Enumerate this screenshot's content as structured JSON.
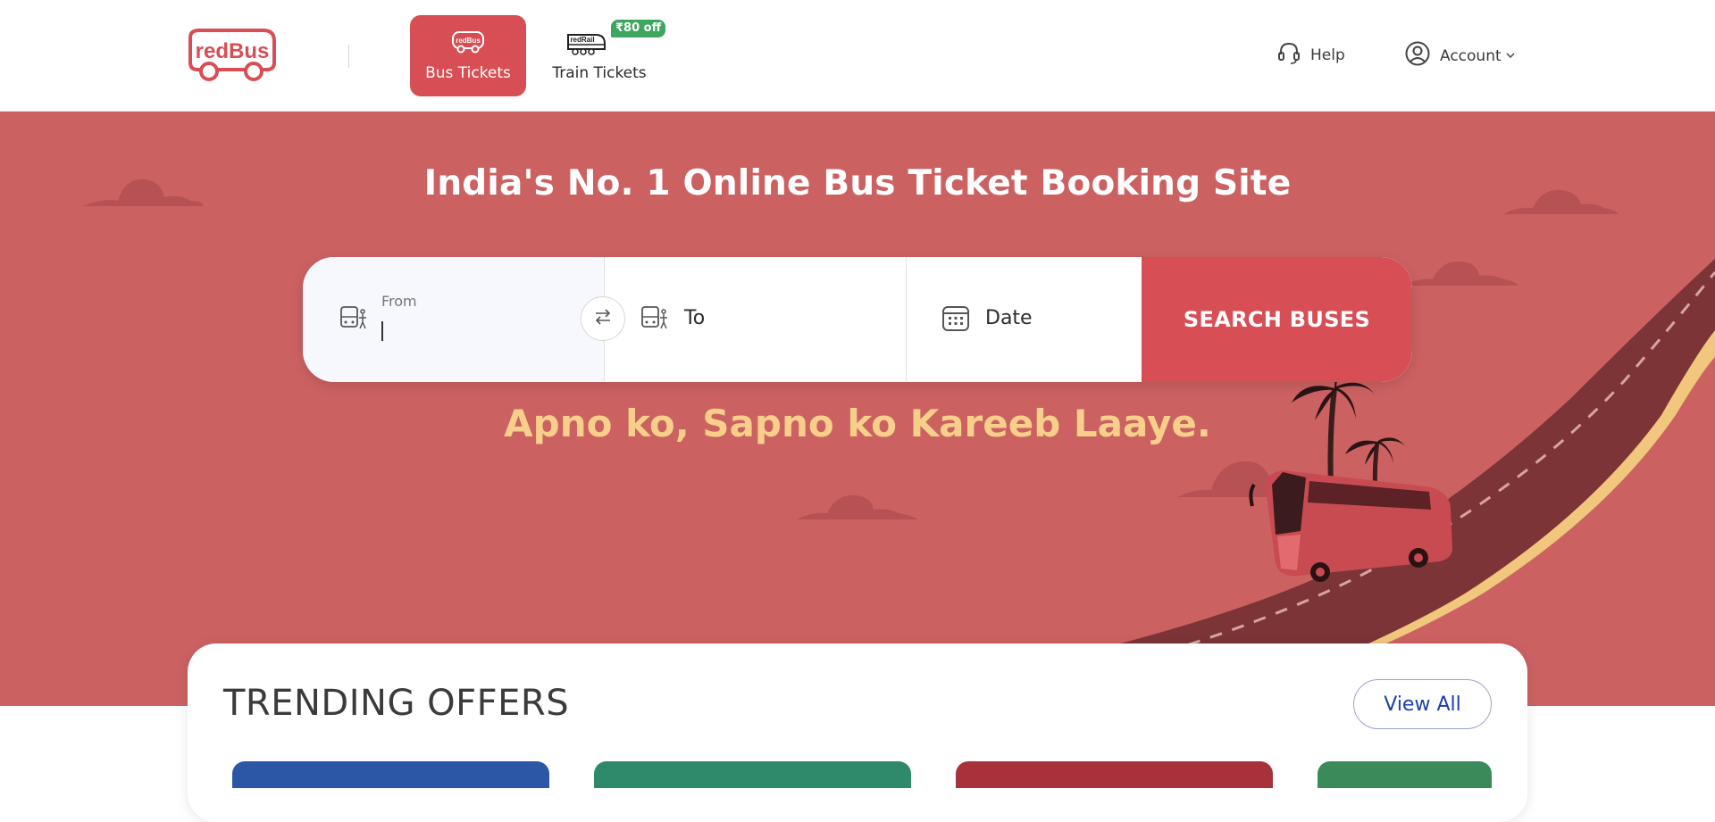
{
  "header": {
    "logo_text": "redBus",
    "tabs": [
      {
        "label": "Bus Tickets",
        "icon": "bus-icon",
        "active": true
      },
      {
        "label": "Train Tickets",
        "icon": "train-icon",
        "active": false
      }
    ],
    "train_badge": "₹80 off",
    "train_logo_text": "redRail",
    "help_label": "Help",
    "account_label": "Account"
  },
  "hero": {
    "title": "India's No. 1 Online Bus Ticket Booking Site",
    "tagline": "Apno ko, Sapno ko Kareeb Laaye."
  },
  "search": {
    "from_label": "From",
    "from_value": "",
    "to_label": "To",
    "date_label": "Date",
    "button_label": "SEARCH BUSES"
  },
  "offers": {
    "title": "TRENDING OFFERS",
    "view_all_label": "View All"
  },
  "colors": {
    "brand_red": "#d84e55",
    "hero_bg": "#cc6162",
    "tagline": "#f7cf8a",
    "badge_green": "#3fa660",
    "view_all_text": "#1a3fae"
  }
}
